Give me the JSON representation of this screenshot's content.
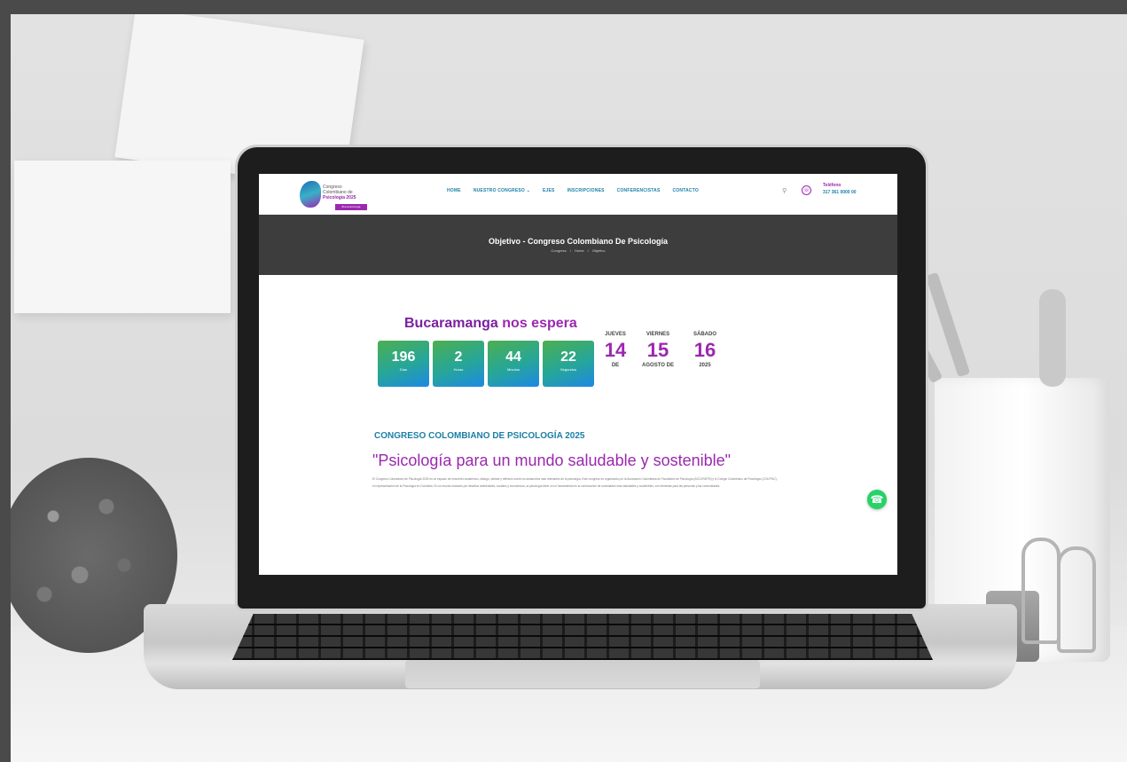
{
  "site": {
    "logo": {
      "line1": "Congreso",
      "line2": "Colombiano de",
      "line3": "Psicología 2025",
      "badge": "Bucaramanga"
    },
    "nav": [
      "HOME",
      "NUESTRO CONGRESO ⌄",
      "EJES",
      "INSCRIPCIONES",
      "CONFERENCISTAS",
      "CONTACTO"
    ],
    "header": {
      "search_icon": "search-icon",
      "phone_label": "Teléfono",
      "phone_number": "317 361 0000 00"
    },
    "title_band": {
      "title": "Objetivo - Congreso Colombiano De Psicología",
      "breadcrumb": [
        "Congreso",
        "/",
        "Home",
        "/",
        "Objetivo"
      ]
    },
    "countdown": {
      "city": "Bucaramanga",
      "rest": " nos espera",
      "units": [
        {
          "value": "196",
          "label": "Días"
        },
        {
          "value": "2",
          "label": "Horas"
        },
        {
          "value": "44",
          "label": "Minutos"
        },
        {
          "value": "22",
          "label": "Segundos"
        }
      ]
    },
    "dates": [
      {
        "day": "JUEVES",
        "num": "14",
        "sub": "DE"
      },
      {
        "day": "VIERNES",
        "num": "15",
        "sub": "AGOSTO DE"
      },
      {
        "day": "SÁBADO",
        "num": "16",
        "sub": "2025"
      }
    ],
    "section": {
      "heading": "CONGRESO COLOMBIANO DE PSICOLOGÍA 2025",
      "tagline": "\"Psicología para un mundo saludable y sostenible\"",
      "body": "El Congreso Colombiano de Psicología 2025 es un espacio de encuentro académico, diálogo, debate y reflexión sobre los desarrollos más relevantes de la psicología. Este congreso es organizado por la Asociación Colombiana de Facultades de Psicología (ASCOFAPSI) y el Colegio Colombiano de Psicólogos (COLPSIC), en representación de la Psicología en Colombia. En un mundo marcado por desafíos ambientales, sociales y económicos, la psicología tiene un rol fundamental en la construcción de sociedades más saludables y sostenibles, con bienestar para las personas y las comunidades."
    },
    "whatsapp_icon": "whatsapp-icon"
  }
}
